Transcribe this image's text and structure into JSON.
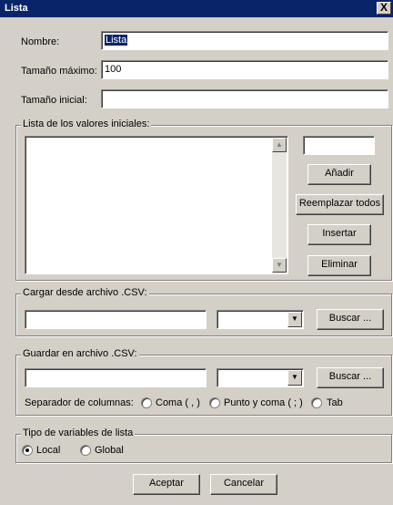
{
  "window": {
    "title": "Lista",
    "close_glyph": "X"
  },
  "form": {
    "nombre_label": "Nombre:",
    "nombre_value": "Lista",
    "tamano_maximo_label": "Tamaño máximo:",
    "tamano_maximo_value": "100",
    "tamano_inicial_label": "Tamaño inicial:",
    "tamano_inicial_value": ""
  },
  "initial_values": {
    "group_title": "Lista de los valores iniciales:",
    "value_input": "",
    "add_label": "Añadir",
    "replace_all_label": "Reemplazar todos",
    "insert_label": "Insertar",
    "delete_label": "Eliminar",
    "scroll_up_icon": "triangle-up",
    "scroll_down_icon": "triangle-down"
  },
  "load_csv": {
    "group_title": "Cargar desde archivo .CSV:",
    "file_value": "",
    "combo_value": "",
    "browse_label": "Buscar ..."
  },
  "save_csv": {
    "group_title": "Guardar en archivo .CSV:",
    "file_value": "",
    "combo_value": "",
    "browse_label": "Buscar ...",
    "separator_label": "Separador de columnas:",
    "options": [
      "Coma ( , )",
      "Punto y coma ( ; )",
      "Tab"
    ]
  },
  "var_type": {
    "group_title": "Tipo de variables de lista",
    "options": [
      "Local",
      "Global"
    ],
    "selected": "Local"
  },
  "footer": {
    "accept_label": "Aceptar",
    "cancel_label": "Cancelar"
  }
}
